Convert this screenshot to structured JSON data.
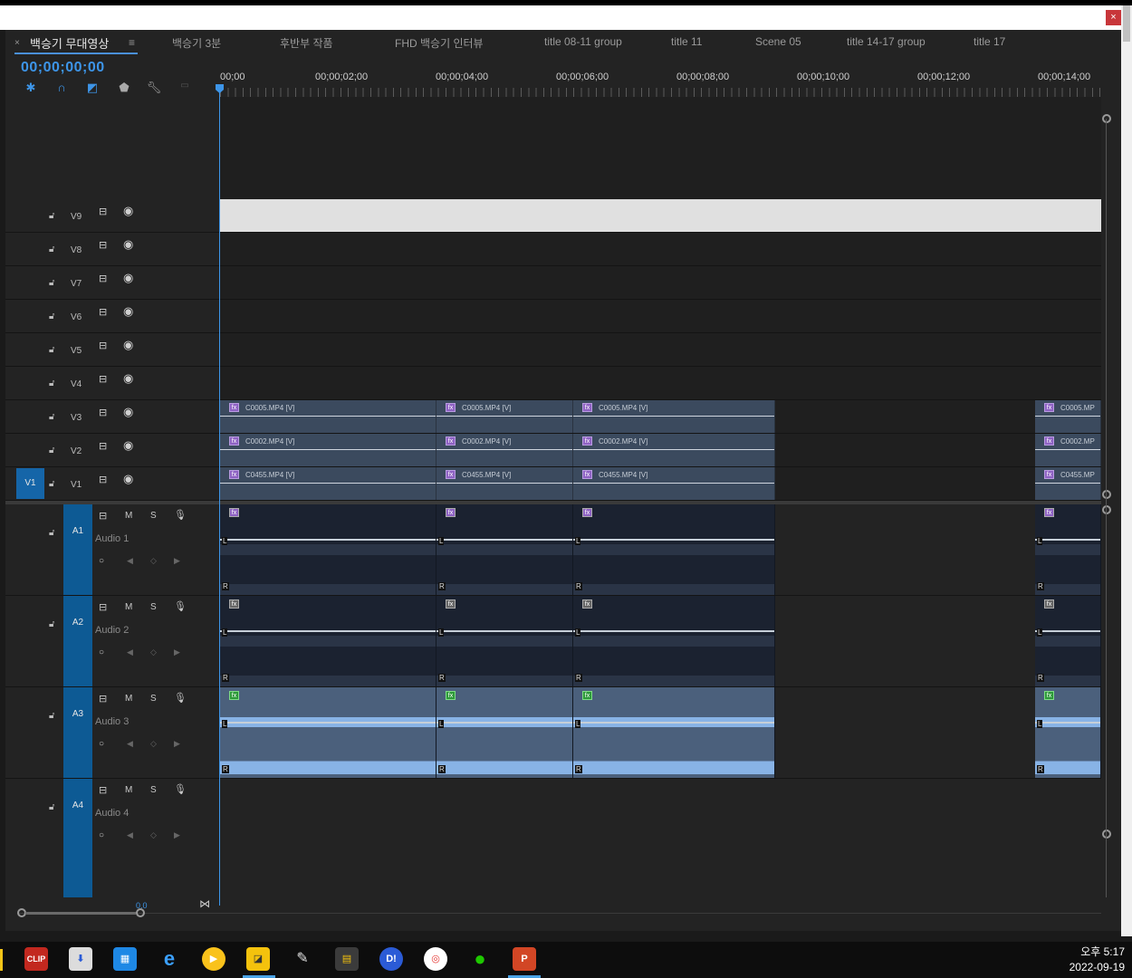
{
  "window": {
    "close_label": "×"
  },
  "tabs": [
    {
      "close": "×",
      "label": "백승기 무대영상",
      "menu": "≡"
    },
    {
      "label": "백승기 3분"
    },
    {
      "label": "후반부 작품"
    },
    {
      "label": "FHD 백승기 인터뷰"
    },
    {
      "label": "title 08-11 group"
    },
    {
      "label": "title 11"
    },
    {
      "label": "Scene 05"
    },
    {
      "label": "title 14-17 group"
    },
    {
      "label": "title 17"
    }
  ],
  "timecode": "00;00;00;00",
  "ruler": [
    "00;00",
    "00;00;02;00",
    "00;00;04;00",
    "00;00;06;00",
    "00;00;08;00",
    "00;00;10;00",
    "00;00;12;00",
    "00;00;14;00"
  ],
  "video_tracks": [
    {
      "name": "V9"
    },
    {
      "name": "V8"
    },
    {
      "name": "V7"
    },
    {
      "name": "V6"
    },
    {
      "name": "V5"
    },
    {
      "name": "V4"
    },
    {
      "name": "V3",
      "clip": "C0005.MP4 [V]",
      "clip_cut": "C0005.MP"
    },
    {
      "name": "V2",
      "clip": "C0002.MP4 [V]",
      "clip_cut": "C0002.MP"
    },
    {
      "name": "V1",
      "clip": "C0455.MP4 [V]",
      "clip_cut": "C0455.MP",
      "target": "V1"
    }
  ],
  "audio_tracks": [
    {
      "id": "A1",
      "label": "Audio 1"
    },
    {
      "id": "A2",
      "label": "Audio 2"
    },
    {
      "id": "A3",
      "label": "Audio 3"
    },
    {
      "id": "A4",
      "label": "Audio 4"
    }
  ],
  "audio_buttons": {
    "m": "M",
    "s": "S",
    "l": "L",
    "r": "R",
    "fx": "fx"
  },
  "zoom_value": "0.0",
  "taskbar": {
    "apps": [
      "clip-studio",
      "installer",
      "calendar",
      "internet-explorer",
      "media-player",
      "sticky-notes",
      "paint",
      "movie-maker",
      "daum",
      "chrome",
      "naver-band",
      "powerpoint"
    ],
    "clip_label": "CLIP",
    "d_label": "D!",
    "p_label": "P"
  },
  "clock": {
    "time": "오후 5:17",
    "date": "2022-09-19"
  }
}
